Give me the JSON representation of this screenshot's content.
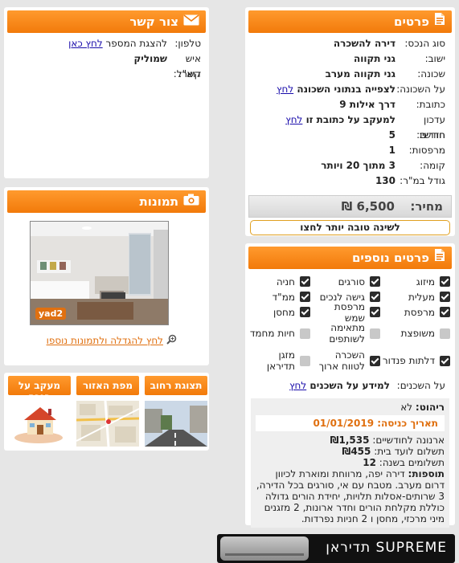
{
  "details": {
    "title": "פרטים",
    "rows": [
      {
        "label": "סוג הנכס:",
        "value": "דירה להשכרה"
      },
      {
        "label": "ישוב:",
        "value": "גני תקווה"
      },
      {
        "label": "שכונה:",
        "value": "גני תקווה מערב"
      },
      {
        "label": "על השכונה:",
        "value": "לצפייה בנתוני השכונה",
        "link": "לחץ"
      },
      {
        "label": "כתובת:",
        "value": "דרך אילות 9"
      },
      {
        "label": "עדכון חודשי:",
        "value": "למעקב על כתובת זו",
        "link": "לחץ"
      },
      {
        "label": "חדרים:",
        "value": "5"
      },
      {
        "label": "מרפסות:",
        "value": "1"
      },
      {
        "label": "קומה:",
        "value": "3 מתוך 20 ויותר"
      },
      {
        "label": "גודל במ\"ר:",
        "value": "130"
      }
    ],
    "price_label": "מחיר:",
    "price_value": "6,500 ₪",
    "boost_text": "לשינה טובה יותר לחצו"
  },
  "more": {
    "title": "פרטים נוספים",
    "features": [
      {
        "label": "מיזוג",
        "on": true
      },
      {
        "label": "סורגים",
        "on": true
      },
      {
        "label": "חניה",
        "on": true
      },
      {
        "label": "מעלית",
        "on": true
      },
      {
        "label": "גישה לנכים",
        "on": true
      },
      {
        "label": "ממ\"ד",
        "on": true
      },
      {
        "label": "מרפסת",
        "on": true
      },
      {
        "label": "מרפסת שמש",
        "on": true
      },
      {
        "label": "מחסן",
        "on": true
      },
      {
        "label": "משופצת",
        "on": false
      },
      {
        "label": "מתאימה לשותפים",
        "on": false
      },
      {
        "label": "חיות מחמד",
        "on": false
      },
      {
        "label": "דלתות פנדור",
        "on": true
      },
      {
        "label": "השכרה לטווח ארוך",
        "on": true
      },
      {
        "label": "מזגן תדיראן",
        "on": false
      }
    ],
    "neighbors_label": "על השכנים:",
    "neighbors_value": "למידע על השכנים",
    "neighbors_link": "לחץ",
    "furniture_label": "ריהוט:",
    "furniture_value": "לא",
    "entry_date": "תאריך כניסה: 01/01/2019",
    "arnona_label": "ארנונה לחודשיים:",
    "arnona_value": "₪1,535",
    "vaad_label": "תשלום לועד בית:",
    "vaad_value": "₪455",
    "payments_label": "תשלומים בשנה:",
    "payments_value": "12",
    "extras_label": "תוספות:",
    "extras_value": "דירה יפה, מרווחת ומוארת לכיוון דרום מערב. מטבח עם אי, סורגים בכל הדירה, 3 שרותים-אסלות תלויות, יחידת הורים גדולה כוללת מקלחת הורים וחדר ארונות, 2 מזגנים מיני מרכזי, מחסן ו 2 חניות נפרדות."
  },
  "contact": {
    "title": "צור קשר",
    "phone_label": "טלפון:",
    "phone_text": "להצגת המספר",
    "phone_link": "לחץ כאן",
    "person_label": "איש קשר:",
    "person_value": "שמוליק",
    "email_label": "דוא\"ל:"
  },
  "images": {
    "title": "תמונות",
    "watermark": "yad2",
    "enlarge_text": "לחץ להגדלה ולתמונות נוספו"
  },
  "thumbs": [
    {
      "label": "תצוגת רחוב"
    },
    {
      "label": "מפת האזור"
    },
    {
      "label": "מעקב על בנכס"
    }
  ],
  "banner": {
    "text": "תדיראן SUPREME"
  },
  "colors": {
    "accent": "#f27a0a",
    "link": "#1a0dab"
  }
}
